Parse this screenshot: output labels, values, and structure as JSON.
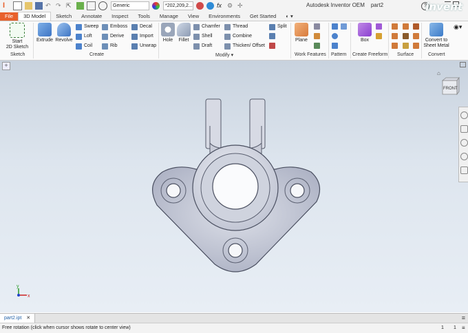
{
  "app": {
    "title": "Autodesk Inventor OEM",
    "document": "part2",
    "logo_text": "invent"
  },
  "qat": {
    "material": "Generic",
    "appearance": "*202,209,2..."
  },
  "tabs": [
    "File",
    "3D Model",
    "Sketch",
    "Annotate",
    "Inspect",
    "Tools",
    "Manage",
    "View",
    "Environments",
    "Get Started"
  ],
  "active_tab": "3D Model",
  "ribbon": {
    "sketch": {
      "label": "Sketch",
      "start": "Start",
      "start2": "2D Sketch"
    },
    "create": {
      "label": "Create",
      "extrude": "Extrude",
      "revolve": "Revolve",
      "col1": [
        "Sweep",
        "Loft",
        "Coil"
      ],
      "col2": [
        "Emboss",
        "Derive",
        "Rib"
      ],
      "col3": [
        "Decal",
        "Import",
        "Unwrap"
      ]
    },
    "modify": {
      "label": "Modify",
      "hole": "Hole",
      "fillet": "Fillet",
      "col1": [
        "Chamfer",
        "Shell",
        "Draft"
      ],
      "col2": [
        "Thread",
        "Combine",
        "Thicken/ Offset"
      ],
      "col3": [
        "Split"
      ]
    },
    "work_features": {
      "label": "Work Features",
      "plane": "Plane"
    },
    "pattern": {
      "label": "Pattern"
    },
    "freeform": {
      "label": "Create Freeform",
      "box": "Box"
    },
    "surface": {
      "label": "Surface"
    },
    "convert": {
      "label": "Convert",
      "btn1": "Convert to",
      "btn2": "Sheet Metal"
    }
  },
  "viewcube": {
    "face": "FRONT"
  },
  "triad": {
    "x": "x",
    "y": "y"
  },
  "doc_tab": {
    "name": "part2.ipt"
  },
  "status": {
    "message": "Free rotation (click when cursor shows rotate to center view)",
    "count1": "1",
    "count2": "1"
  },
  "colors": {
    "file_tab": "#e8612c",
    "viewport_top": "#c8d2de",
    "part": "#b9bfd0"
  }
}
